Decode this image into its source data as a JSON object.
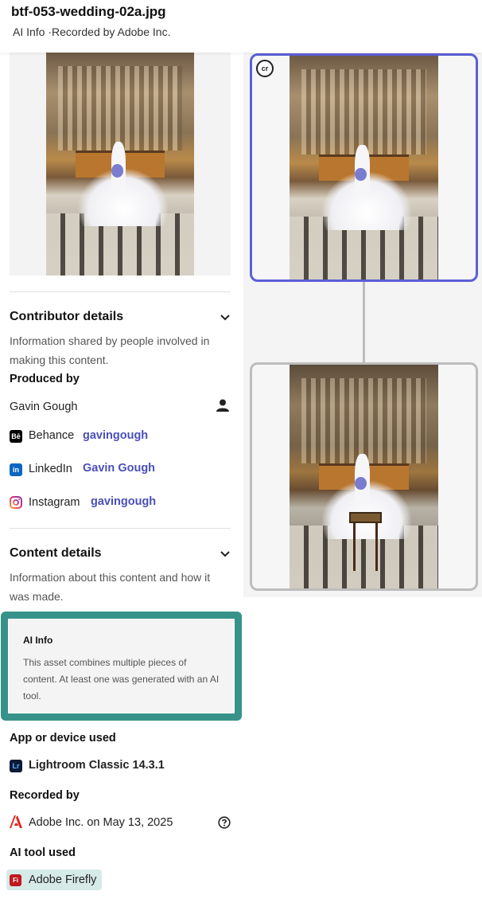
{
  "header": {
    "file_name": "btf-053-wedding-02a.jpg",
    "subtitle": "AI Info ·Recorded by Adobe Inc."
  },
  "contributor": {
    "title": "Contributor details",
    "description": "Information shared by people involved in making this content.",
    "produced_by_label": "Produced by",
    "producer_name": "Gavin Gough",
    "socials": [
      {
        "icon": "behance-icon",
        "platform": "Behance",
        "handle": "gavingough",
        "color": "#000000"
      },
      {
        "icon": "linkedin-icon",
        "platform": "LinkedIn",
        "handle": "Gavin Gough",
        "color": "#0a66c2"
      },
      {
        "icon": "instagram-icon",
        "platform": "Instagram",
        "handle": "gavingough",
        "color": "#d6249f"
      }
    ]
  },
  "content": {
    "title": "Content details",
    "description": "Information about this content and how it was made.",
    "ai_info_title": "AI Info",
    "ai_info_desc": "This asset combines multiple pieces of content. At least one was generated with an AI tool.",
    "app_label": "App or device used",
    "app_value": "Lightroom Classic 14.3.1",
    "recorded_label": "Recorded by",
    "recorded_value": "Adobe Inc. on May 13, 2025",
    "ai_tool_label": "AI tool used",
    "ai_tool_value": "Adobe Firefly"
  },
  "icons": {
    "behance": "Bē",
    "linkedin": "in",
    "lightroom": "Lr",
    "firefly": "Fi",
    "content_credentials": "cr"
  },
  "colors": {
    "accent_blue": "#5b5fd6",
    "link": "#4a4fb8",
    "ai_frame": "#37928a",
    "firefly_highlight": "#d6eae8"
  }
}
